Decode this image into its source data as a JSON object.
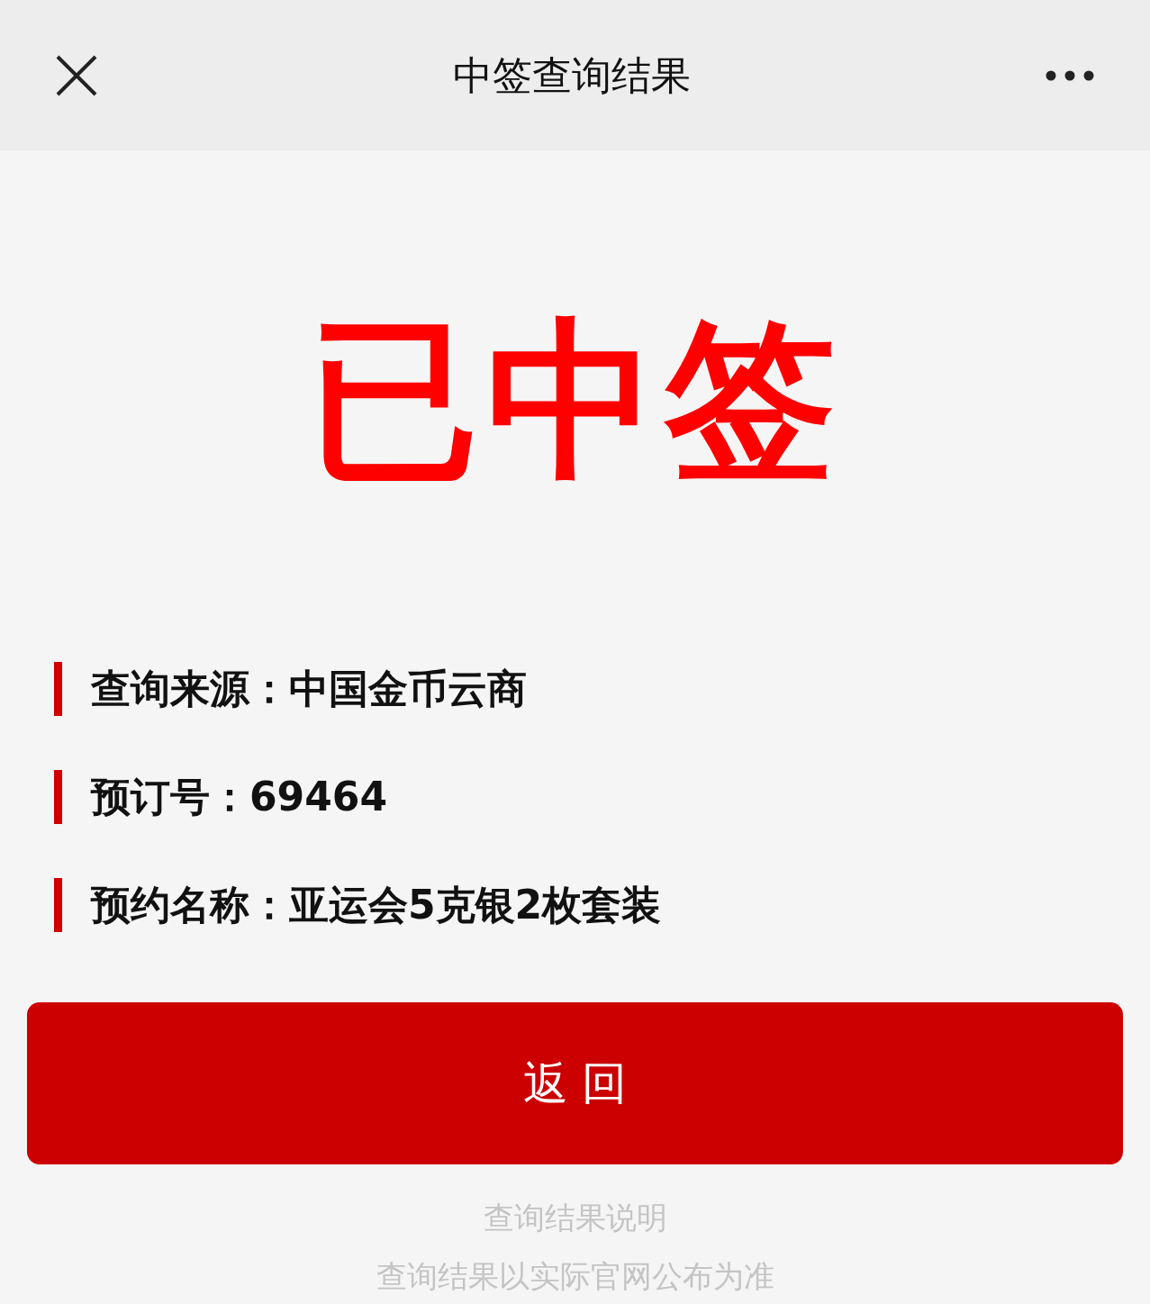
{
  "header": {
    "title": "中签查询结果"
  },
  "result": "已中签",
  "info_rows": [
    "查询来源：中国金币云商",
    "预订号：69464",
    "预约名称：亚运会5克银2枚套装"
  ],
  "button": "返 回",
  "footer": {
    "title": "查询结果说明",
    "note": "查询结果以实际官网公布为准"
  }
}
